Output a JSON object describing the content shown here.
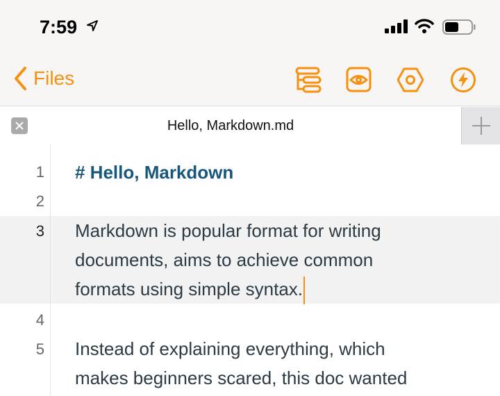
{
  "status_bar": {
    "time": "7:59",
    "battery_level": 0.5
  },
  "nav": {
    "back_label": "Files",
    "accent": "#f6900e",
    "icons": [
      "outline-icon",
      "preview-icon",
      "settings-icon",
      "actions-icon"
    ]
  },
  "tab": {
    "title": "Hello, Markdown.md"
  },
  "editor": {
    "lines": [
      {
        "num": "1",
        "text": "# Hello, Markdown"
      },
      {
        "num": "2",
        "text": ""
      },
      {
        "num": "3",
        "text": [
          "Markdown is popular format for writing",
          "documents, aims to achieve common",
          "formats using simple syntax."
        ]
      },
      {
        "num": "4",
        "text": ""
      },
      {
        "num": "5",
        "text": [
          "Instead of explaining everything, which",
          "makes beginners scared, this doc wanted"
        ]
      }
    ]
  }
}
